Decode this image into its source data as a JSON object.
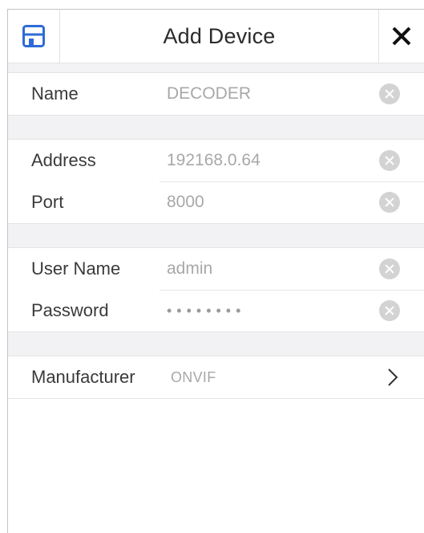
{
  "header": {
    "title": "Add Device",
    "save_icon": "save-icon",
    "close_icon": "close-icon",
    "accent_color": "#2e6bd6"
  },
  "fields": {
    "name": {
      "label": "Name",
      "value": "DECODER"
    },
    "address": {
      "label": "Address",
      "value": "192168.0.64"
    },
    "port": {
      "label": "Port",
      "value": "8000"
    },
    "username": {
      "label": "User Name",
      "value": "admin"
    },
    "password": {
      "label": "Password",
      "value": "••••••••"
    },
    "manufacturer": {
      "label": "Manufacturer",
      "value": "ONVIF"
    }
  }
}
